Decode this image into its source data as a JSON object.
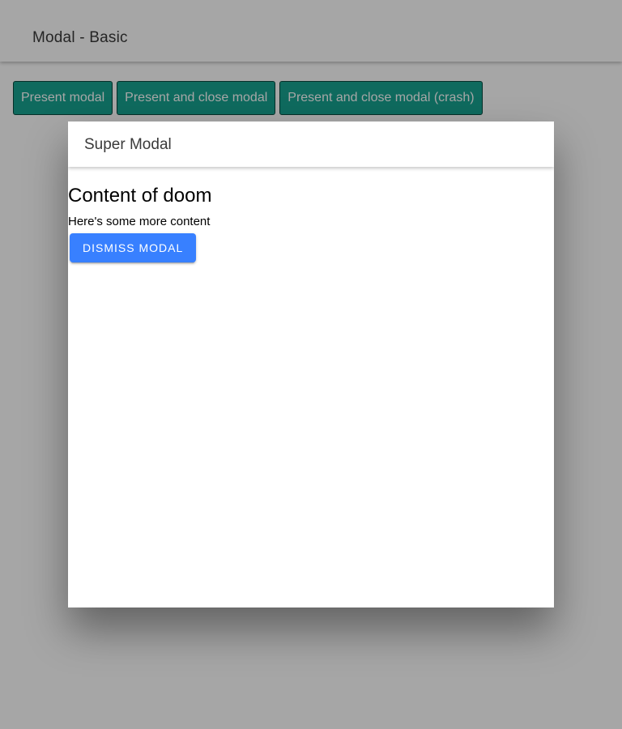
{
  "header": {
    "title": "Modal - Basic"
  },
  "toolbar": {
    "buttons": [
      {
        "label": "Present modal"
      },
      {
        "label": "Present and close modal"
      },
      {
        "label": "Present and close modal (crash)"
      }
    ]
  },
  "modal": {
    "title": "Super Modal",
    "content": {
      "heading": "Content of doom",
      "text": "Here's some more content",
      "dismiss_label": "Dismiss Modal"
    }
  },
  "colors": {
    "toolbar_button_bg": "#17a491",
    "toolbar_button_border": "#0a4a40",
    "primary": "#3880ff",
    "backdrop": "rgba(0,0,0,0.35)"
  }
}
